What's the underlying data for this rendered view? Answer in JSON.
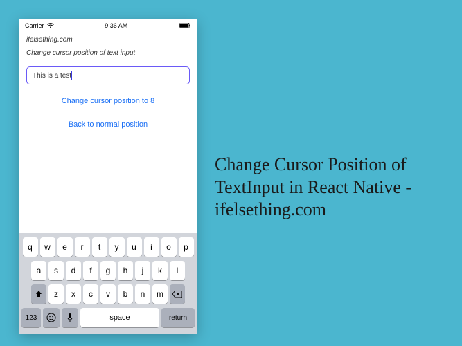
{
  "status_bar": {
    "carrier": "Carrier",
    "time": "9:36 AM"
  },
  "app": {
    "site_label": "ifelsething.com",
    "description": "Change cursor position of text input",
    "input_value": "This is a test",
    "button1_label": "Change cursor position to 8",
    "button2_label": "Back to normal position"
  },
  "keyboard": {
    "row1": [
      "q",
      "w",
      "e",
      "r",
      "t",
      "y",
      "u",
      "i",
      "o",
      "p"
    ],
    "row2": [
      "a",
      "s",
      "d",
      "f",
      "g",
      "h",
      "j",
      "k",
      "l"
    ],
    "row3": [
      "z",
      "x",
      "c",
      "v",
      "b",
      "n",
      "m"
    ],
    "num_label": "123",
    "space_label": "space",
    "return_label": "return"
  },
  "caption": "Change Cursor Position of TextInput in React Native - ifelsething.com"
}
